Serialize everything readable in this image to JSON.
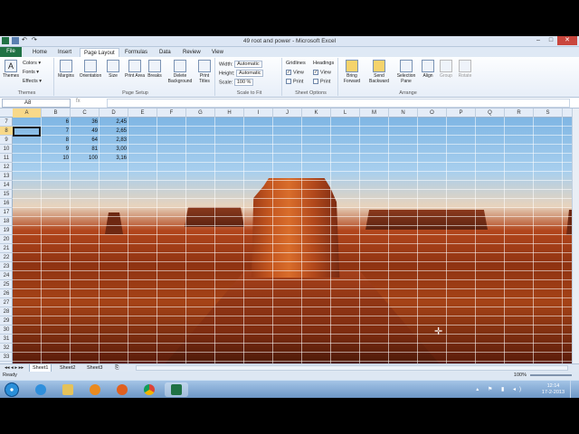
{
  "window": {
    "title": "49 root and power - Microsoft Excel",
    "minimize": "–",
    "maximize": "□",
    "close": "✕"
  },
  "tabs": [
    {
      "label": "File"
    },
    {
      "label": "Home"
    },
    {
      "label": "Insert"
    },
    {
      "label": "Page Layout"
    },
    {
      "label": "Formulas"
    },
    {
      "label": "Data"
    },
    {
      "label": "Review"
    },
    {
      "label": "View"
    }
  ],
  "ribbon": {
    "themes": {
      "big": "Themes",
      "colors": "Colors",
      "fonts": "Fonts",
      "effects": "Effects",
      "group": "Themes"
    },
    "page_setup": {
      "margins": "Margins",
      "orientation": "Orientation",
      "size": "Size",
      "print_area": "Print Area",
      "breaks": "Breaks",
      "background": "Delete Background",
      "print_titles": "Print Titles",
      "group": "Page Setup"
    },
    "scale": {
      "width_label": "Width:",
      "width_value": "Automatic",
      "height_label": "Height:",
      "height_value": "Automatic",
      "scale_label": "Scale:",
      "scale_value": "100 %",
      "group": "Scale to Fit"
    },
    "sheet_options": {
      "gridlines": "Gridlines",
      "headings": "Headings",
      "view": "View",
      "print": "Print",
      "group": "Sheet Options"
    },
    "arrange": {
      "bring_forward": "Bring Forward",
      "send_backward": "Send Backward",
      "selection_pane": "Selection Pane",
      "align": "Align",
      "group_btn": "Group",
      "rotate": "Rotate",
      "group": "Arrange"
    }
  },
  "formula_bar": {
    "name_box": "A8",
    "fx": "fx",
    "content": ""
  },
  "columns": [
    "A",
    "B",
    "C",
    "D",
    "E",
    "F",
    "G",
    "H",
    "I",
    "J",
    "K",
    "L",
    "M",
    "N",
    "O",
    "P",
    "Q",
    "R",
    "S"
  ],
  "rows": [
    "7",
    "8",
    "9",
    "10",
    "11",
    "12",
    "13",
    "14",
    "15",
    "16",
    "17",
    "18",
    "19",
    "20",
    "21",
    "22",
    "23",
    "24",
    "25",
    "26",
    "27",
    "28",
    "29",
    "30",
    "31",
    "32",
    "33"
  ],
  "cells": [
    {
      "b": "6",
      "c": "36",
      "d": "2,45"
    },
    {
      "b": "7",
      "c": "49",
      "d": "2,65"
    },
    {
      "b": "8",
      "c": "64",
      "d": "2,83"
    },
    {
      "b": "9",
      "c": "81",
      "d": "3,00"
    },
    {
      "b": "10",
      "c": "100",
      "d": "3,16"
    }
  ],
  "sheets": [
    "Sheet1",
    "Sheet2",
    "Sheet3"
  ],
  "status": {
    "ready": "Ready",
    "zoom": "100%"
  },
  "taskbar": {
    "time": "12:14",
    "date": "17-2-2013"
  }
}
